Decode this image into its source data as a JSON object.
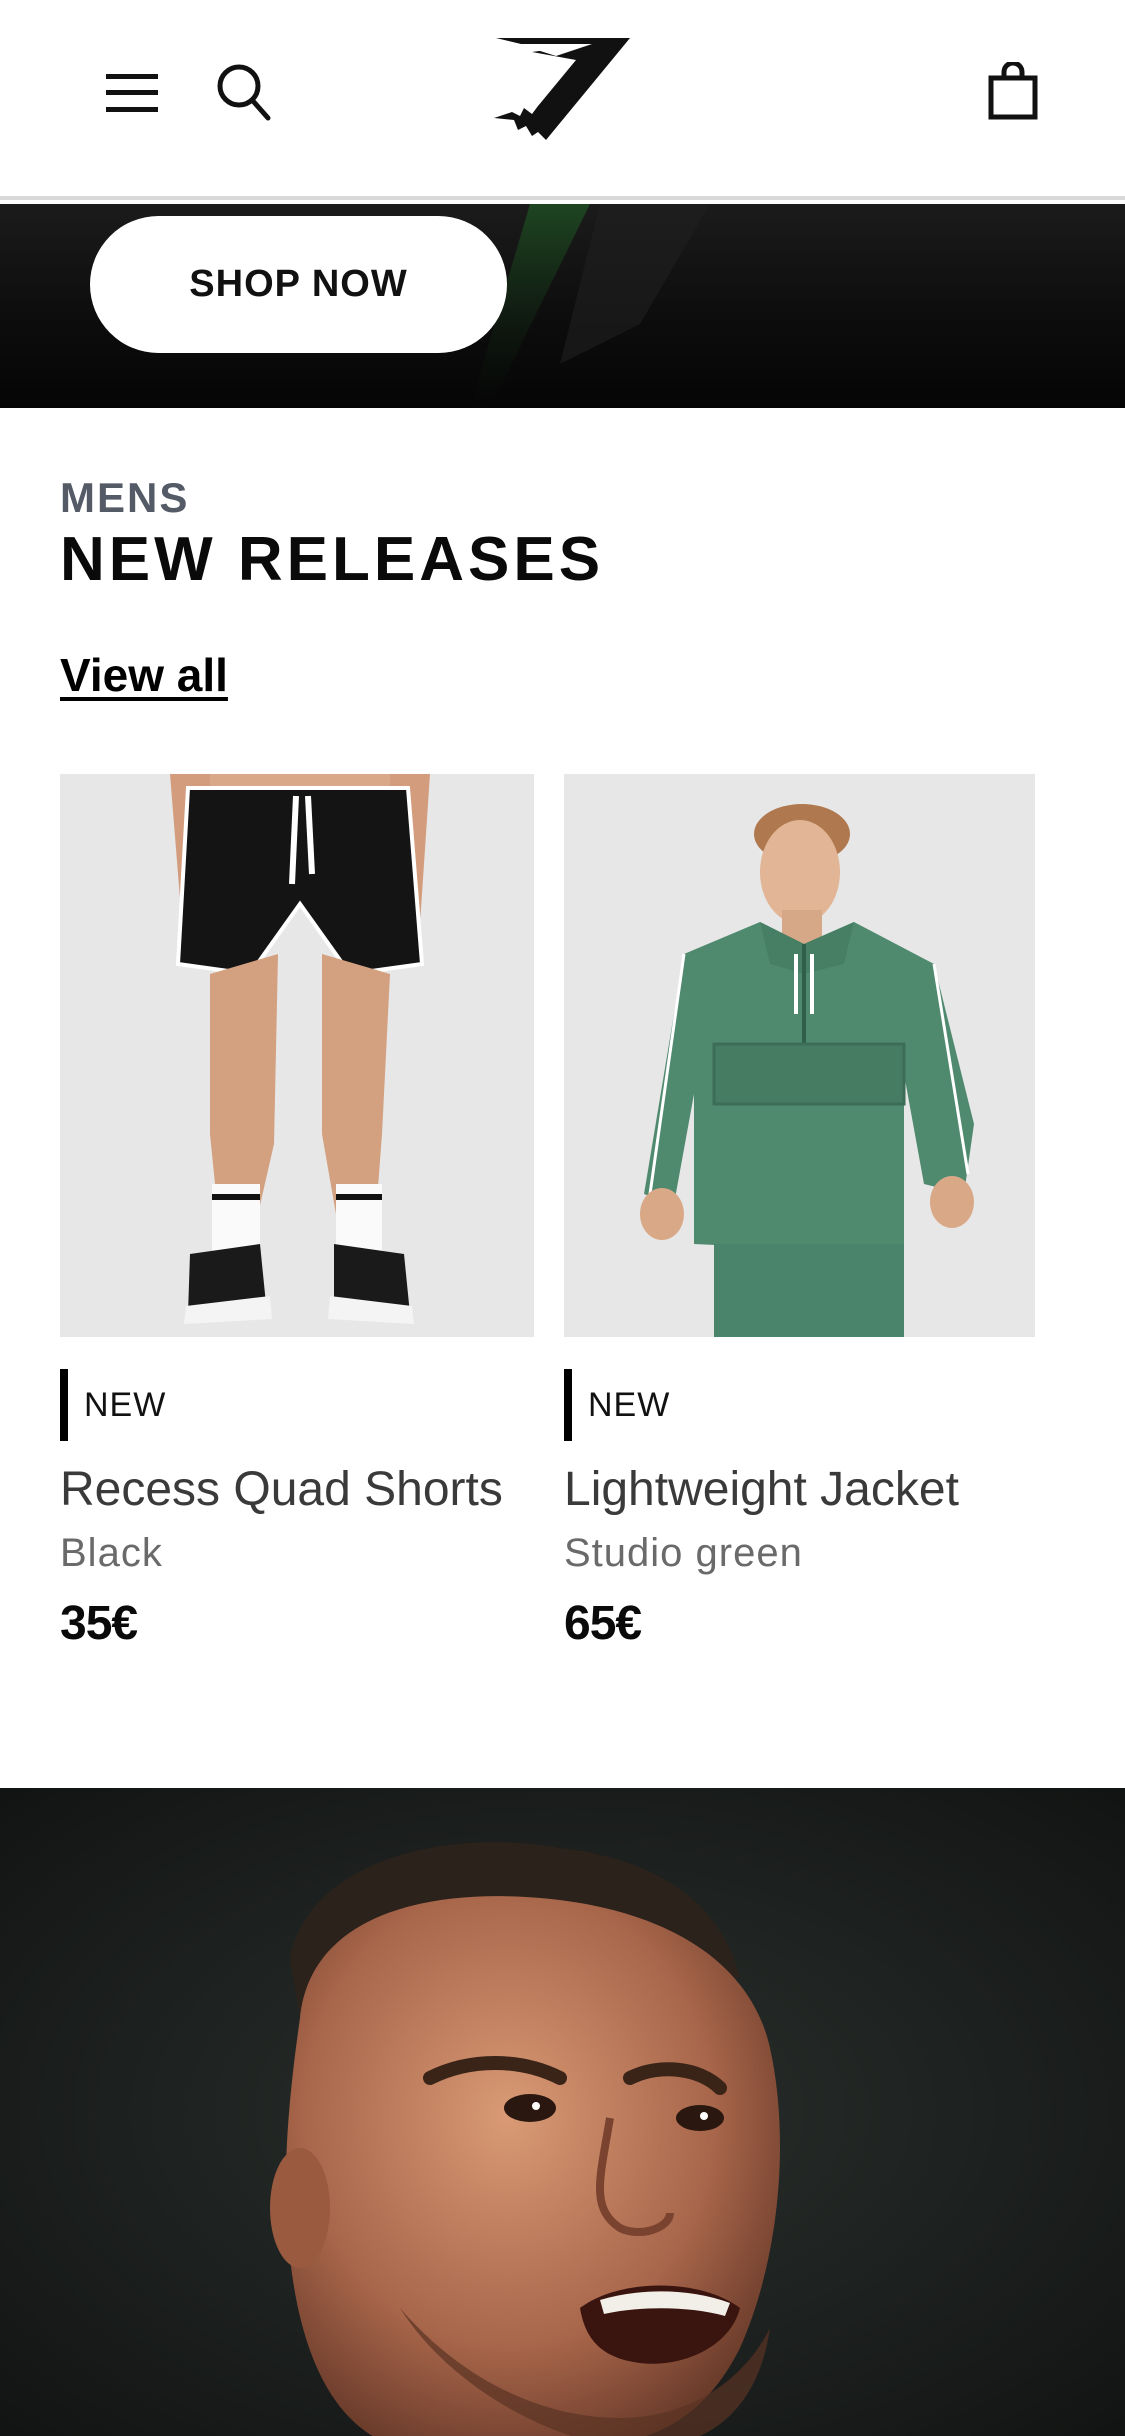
{
  "header": {
    "menu_icon": "hamburger-menu-icon",
    "search_icon": "search-icon",
    "logo": "gymshark-logo",
    "bag_icon": "shopping-bag-icon"
  },
  "hero": {
    "button_label": "SHOP NOW"
  },
  "section": {
    "kicker": "MENS",
    "title": "NEW RELEASES",
    "view_all": "View all"
  },
  "products": [
    {
      "badge": "NEW",
      "name": "Recess Quad Shorts",
      "color": "Black",
      "price": "35€"
    },
    {
      "badge": "NEW",
      "name": "Lightweight Jacket",
      "color": "Studio green",
      "price": "65€"
    }
  ],
  "colors": {
    "accent": "#000000",
    "product_bg": "#e7e7e7",
    "jacket_green": "#4f8a6f"
  }
}
